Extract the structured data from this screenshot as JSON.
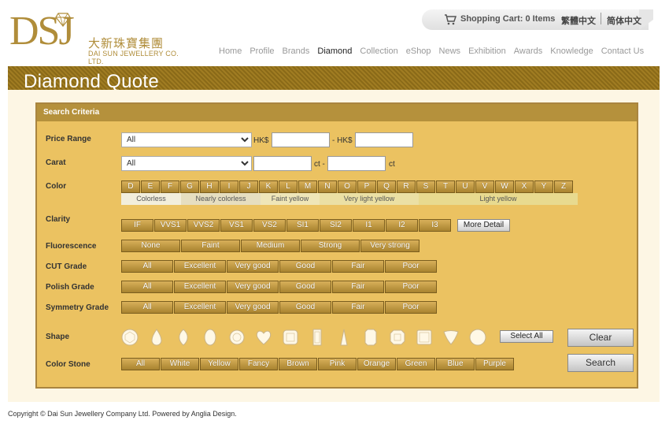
{
  "logo": {
    "mark": "DSJ",
    "cn": "大新珠寶集團",
    "en": "DAI SUN JEWELLERY CO. LTD."
  },
  "topbar": {
    "cart": "Shopping Cart: 0 Items",
    "lang_trad": "繁體中文",
    "lang_simp": "简体中文"
  },
  "nav": [
    "Home",
    "Profile",
    "Brands",
    "Diamond",
    "Collection",
    "eShop",
    "News",
    "Exhibition",
    "Awards",
    "Knowledge",
    "Contact Us"
  ],
  "nav_active": "Diamond",
  "page_title": "Diamond Quote",
  "search": {
    "header": "Search Criteria",
    "price_label": "Price Range",
    "price_value": "All",
    "currency_from": "HK$",
    "currency_to": "- HK$",
    "carat_label": "Carat",
    "carat_value": "All",
    "carat_unit_from": "ct -",
    "carat_unit_to": "ct",
    "color_label": "Color",
    "colors": [
      "D",
      "E",
      "F",
      "G",
      "H",
      "I",
      "J",
      "K",
      "L",
      "M",
      "N",
      "O",
      "P",
      "Q",
      "R",
      "S",
      "T",
      "U",
      "V",
      "W",
      "X",
      "Y",
      "Z"
    ],
    "tones": [
      "Colorless",
      "Nearly colorless",
      "Faint yellow",
      "Very light yellow",
      "Light yellow"
    ],
    "clarity_label": "Clarity",
    "clarity": [
      "IF",
      "VVS1",
      "VVS2",
      "VS1",
      "VS2",
      "SI1",
      "SI2",
      "I1",
      "I2",
      "I3"
    ],
    "more_detail": "More Detail",
    "fluorescence_label": "Fluorescence",
    "fluorescence": [
      "None",
      "Faint",
      "Medium",
      "Strong",
      "Very strong"
    ],
    "cut_label": "CUT Grade",
    "polish_label": "Polish Grade",
    "symmetry_label": "Symmetry Grade",
    "grades": [
      "All",
      "Excellent",
      "Very good",
      "Good",
      "Fair",
      "Poor"
    ],
    "shape_label": "Shape",
    "select_all": "Select All",
    "color_stone_label": "Color Stone",
    "color_stones": [
      "All",
      "White",
      "Yellow",
      "Fancy",
      "Brown",
      "Pink",
      "Orange",
      "Green",
      "Blue",
      "Purple"
    ],
    "clear": "Clear",
    "search_btn": "Search"
  },
  "footer": "Copyright © Dai Sun Jewellery Company Ltd. Powered by Anglia Design.",
  "colors": {
    "gold": "#b08d3a",
    "panel": "#ebc261",
    "banner": "#8a6a18"
  }
}
